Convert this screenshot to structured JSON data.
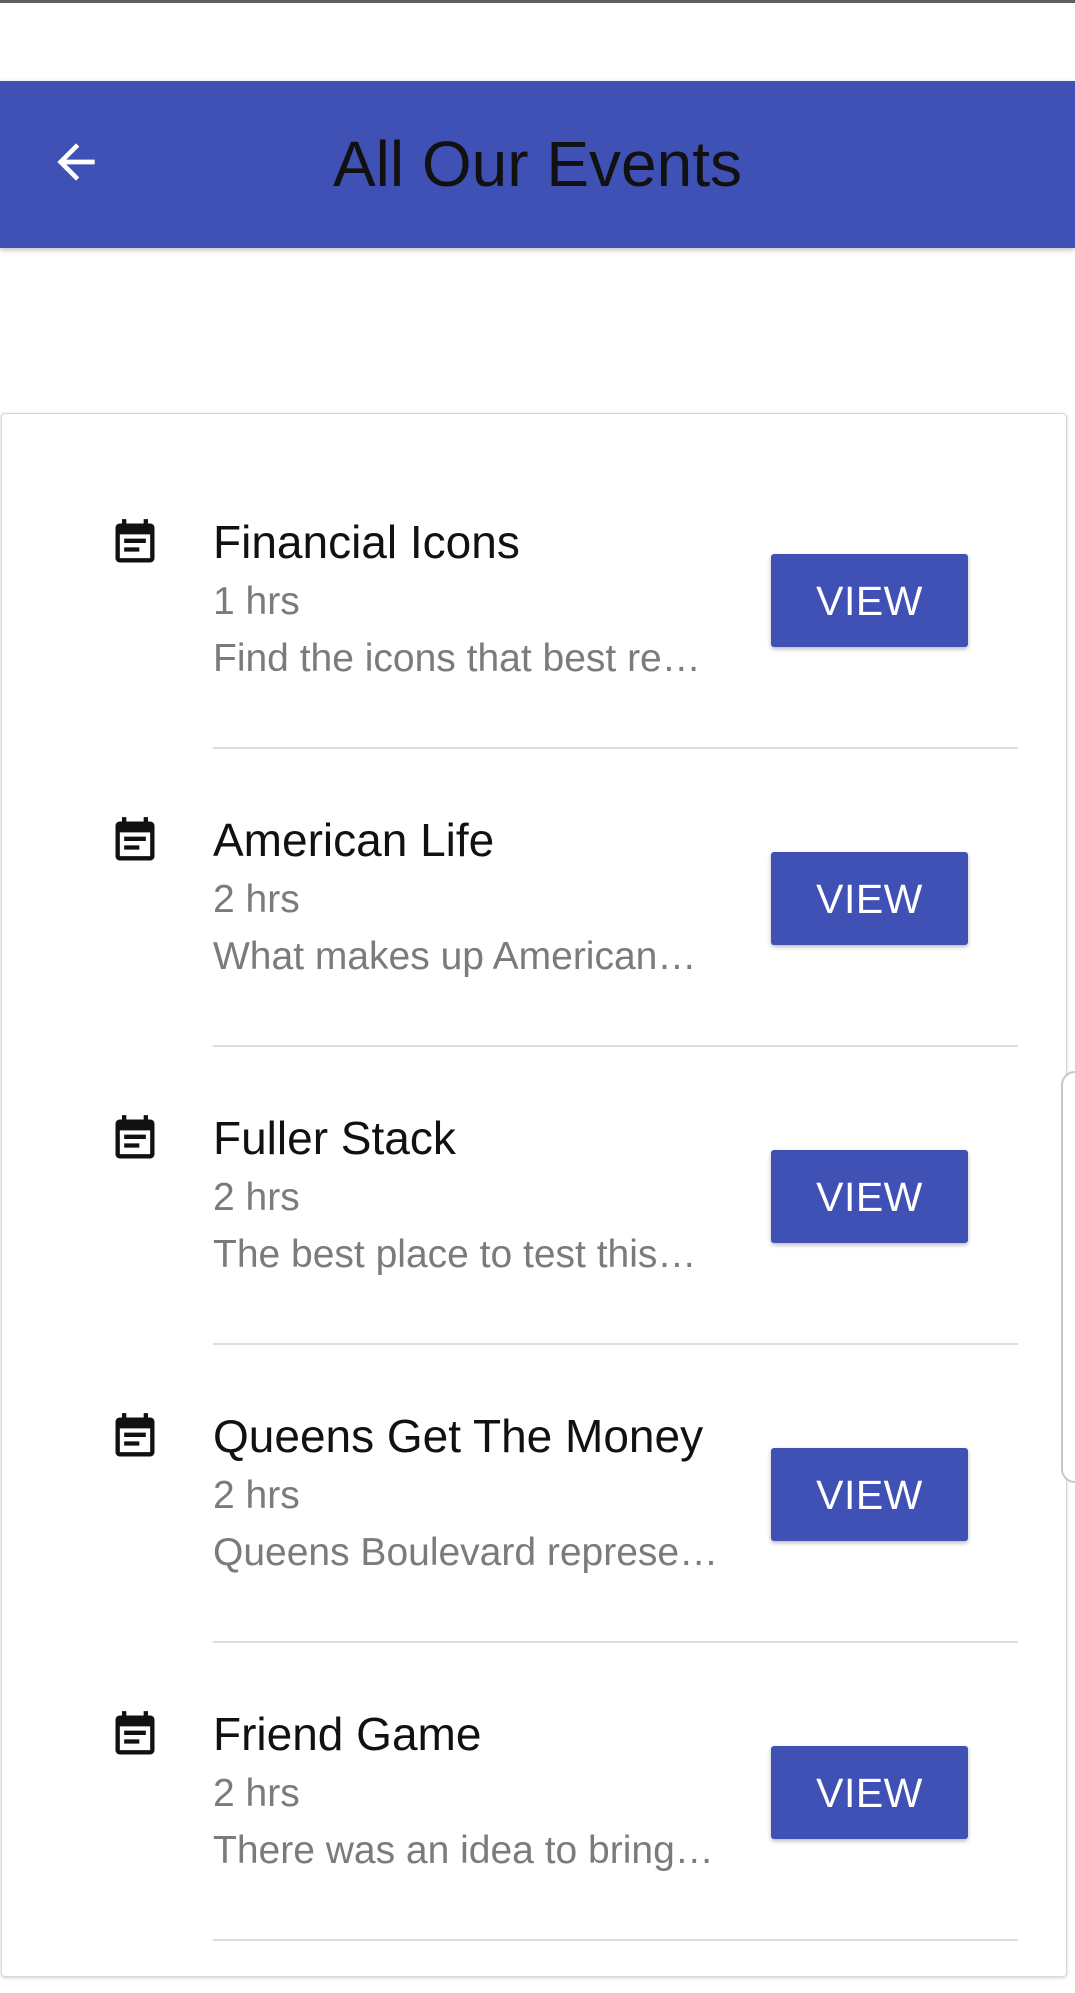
{
  "app_bar": {
    "title": "All Our Events",
    "back_icon": "arrow-back-icon",
    "color": "#3f51b5"
  },
  "events": [
    {
      "title": "Financial Icons",
      "duration": "1 hrs",
      "description": "Find the icons that best re…",
      "icon": "event-note-icon",
      "button_label": "VIEW"
    },
    {
      "title": "American Life",
      "duration": "2 hrs",
      "description": "What makes up American…",
      "icon": "event-note-icon",
      "button_label": "VIEW"
    },
    {
      "title": "Fuller Stack",
      "duration": "2 hrs",
      "description": "The best place to test this…",
      "icon": "event-note-icon",
      "button_label": "VIEW"
    },
    {
      "title": "Queens Get The Money",
      "duration": "2 hrs",
      "description": "Queens Boulevard represe…",
      "icon": "event-note-icon",
      "button_label": "VIEW"
    },
    {
      "title": "Friend Game",
      "duration": "2 hrs",
      "description": "There was an idea to bring…",
      "icon": "event-note-icon",
      "button_label": "VIEW"
    }
  ]
}
